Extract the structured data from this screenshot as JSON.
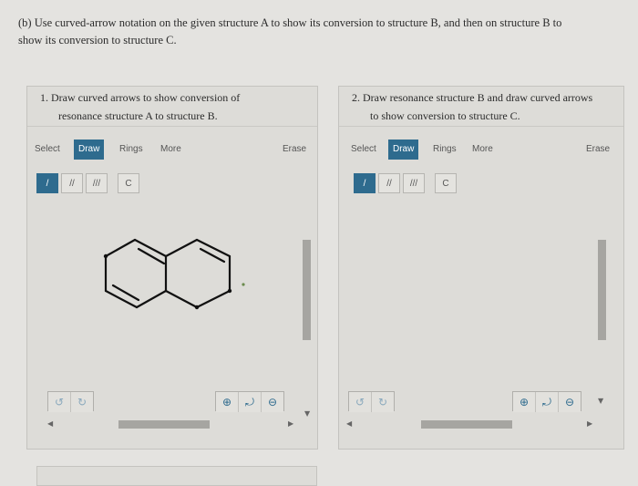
{
  "intro": {
    "line1": "(b) Use curved-arrow notation on the given structure A to show its conversion to structure B, and then on structure B to",
    "line2": "show its conversion to structure C."
  },
  "panels": [
    {
      "prompt_line1": "1. Draw curved arrows to show conversion of",
      "prompt_line2": "resonance structure A to structure B.",
      "toolbar": {
        "select": "Select",
        "draw": "Draw",
        "rings": "Rings",
        "more": "More",
        "erase": "Erase"
      },
      "bonds": {
        "single": "/",
        "double": "//",
        "triple": "///",
        "charge": "C"
      }
    },
    {
      "prompt_line1": "2. Draw resonance structure B and draw curved arrows",
      "prompt_line2": "to show conversion to structure C.",
      "toolbar": {
        "select": "Select",
        "draw": "Draw",
        "rings": "Rings",
        "more": "More",
        "erase": "Erase"
      },
      "bonds": {
        "single": "/",
        "double": "//",
        "triple": "///",
        "charge": "C"
      }
    }
  ],
  "colors": {
    "accent": "#2e6b8e",
    "background": "#e4e3e0"
  },
  "icons": [
    "undo-icon",
    "redo-icon",
    "zoom-in-icon",
    "reset-zoom-icon",
    "zoom-out-icon"
  ]
}
